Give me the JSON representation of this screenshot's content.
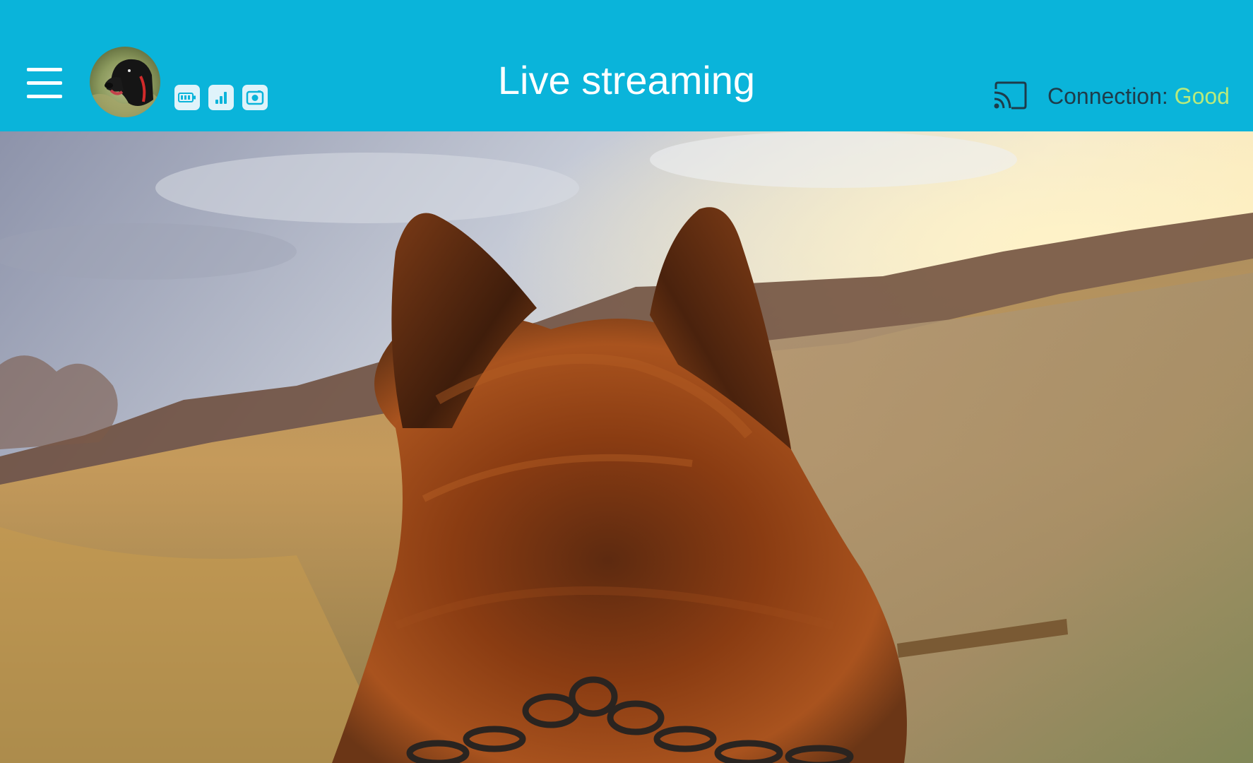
{
  "header": {
    "title": "Live streaming",
    "connection_label": "Connection:",
    "connection_value": "Good"
  },
  "icons": {
    "menu": "hamburger-menu-icon",
    "battery": "battery-icon",
    "stats": "bar-chart-icon",
    "snapshot": "camera-icon",
    "cast": "cast-icon"
  },
  "colors": {
    "header_bg": "#0ab4da",
    "connection_good": "#b8ea7c",
    "header_text": "#ffffff"
  }
}
